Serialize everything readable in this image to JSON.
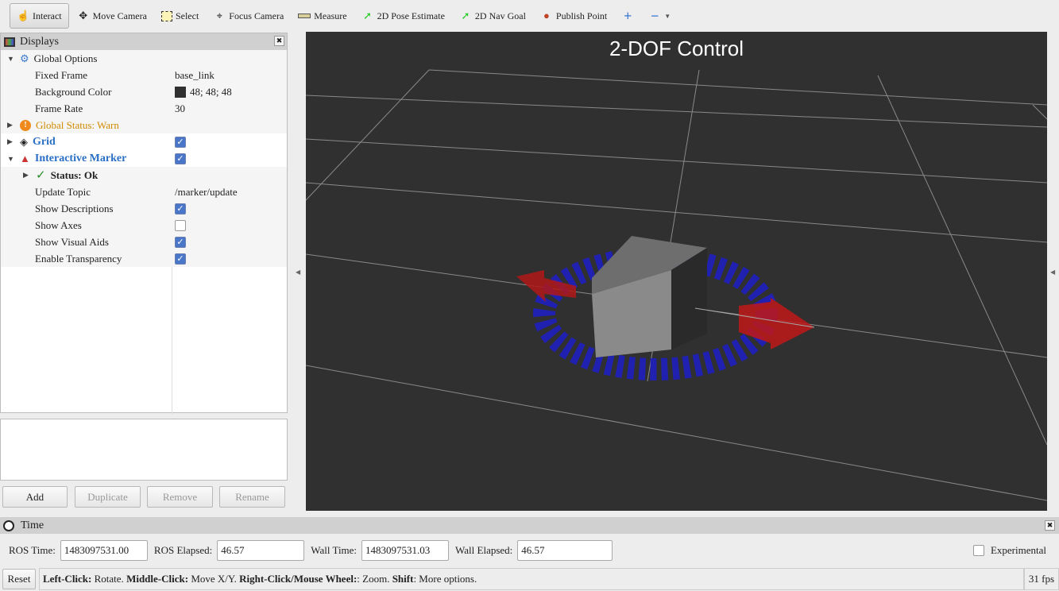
{
  "toolbar": {
    "items": [
      {
        "label": "Interact",
        "icon": "hand-pointer-icon"
      },
      {
        "label": "Move Camera",
        "icon": "move-icon"
      },
      {
        "label": "Select",
        "icon": "select-box-icon"
      },
      {
        "label": "Focus Camera",
        "icon": "crosshair-icon"
      },
      {
        "label": "Measure",
        "icon": "ruler-icon"
      },
      {
        "label": "2D Pose Estimate",
        "icon": "green-arrow-icon"
      },
      {
        "label": "2D Nav Goal",
        "icon": "green-arrow-icon"
      },
      {
        "label": "Publish Point",
        "icon": "map-pin-icon"
      }
    ]
  },
  "displays": {
    "title": "Displays",
    "global_options": "Global Options",
    "fixed_frame": {
      "label": "Fixed Frame",
      "value": "base_link"
    },
    "background_color": {
      "label": "Background Color",
      "value": "48; 48; 48",
      "swatch": "#303030"
    },
    "frame_rate": {
      "label": "Frame Rate",
      "value": "30"
    },
    "global_status": "Global Status: Warn",
    "grid": {
      "label": "Grid",
      "checked": true
    },
    "interactive_marker": {
      "label": "Interactive Marker",
      "checked": true
    },
    "status": "Status: Ok",
    "update_topic": {
      "label": "Update Topic",
      "value": "/marker/update"
    },
    "show_descriptions": {
      "label": "Show Descriptions",
      "checked": true
    },
    "show_axes": {
      "label": "Show Axes",
      "checked": false
    },
    "show_visual_aids": {
      "label": "Show Visual Aids",
      "checked": true
    },
    "enable_transparency": {
      "label": "Enable Transparency",
      "checked": true
    }
  },
  "buttons": {
    "add": "Add",
    "duplicate": "Duplicate",
    "remove": "Remove",
    "rename": "Rename"
  },
  "view": {
    "title": "2-DOF  Control",
    "background": "#303030"
  },
  "time": {
    "title": "Time",
    "ros_time_label": "ROS Time:",
    "ros_time": "1483097531.00",
    "ros_elapsed_label": "ROS Elapsed:",
    "ros_elapsed": "46.57",
    "wall_time_label": "Wall Time:",
    "wall_time": "1483097531.03",
    "wall_elapsed_label": "Wall Elapsed:",
    "wall_elapsed": "46.57",
    "experimental": "Experimental"
  },
  "status": {
    "reset": "Reset",
    "b1": "Left-Click:",
    "t1": " Rotate. ",
    "b2": "Middle-Click:",
    "t2": " Move X/Y. ",
    "b3": "Right-Click/Mouse Wheel:",
    "t3": ": Zoom. ",
    "b4": "Shift",
    "t4": ": More options.",
    "fps": "31 fps"
  }
}
